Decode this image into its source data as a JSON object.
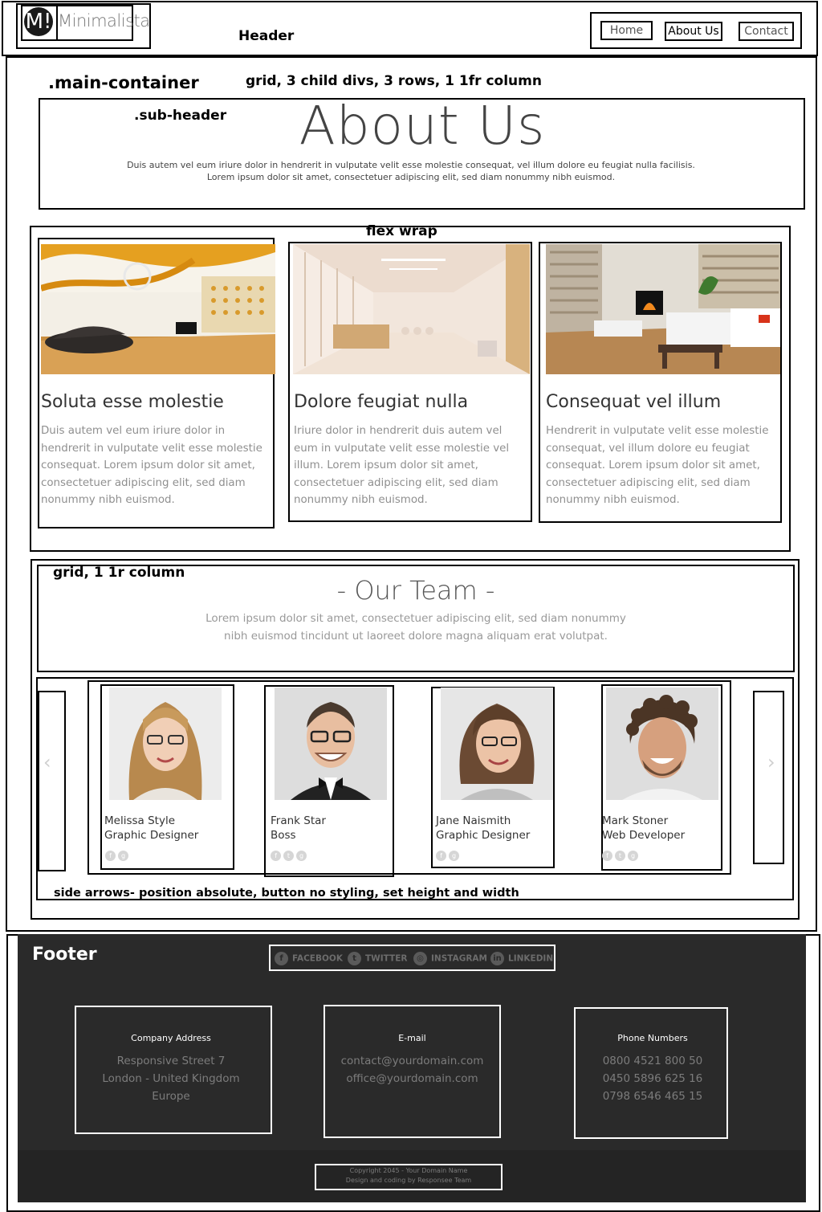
{
  "header": {
    "logo_mark": "M!",
    "logo_text": "Minimalista",
    "nav": [
      "Home",
      "About Us",
      "Contact"
    ]
  },
  "annotations": {
    "header": "Header",
    "main_container": ".main-container",
    "main_grid": "grid, 3 child divs, 3 rows, 1 1fr column",
    "sub_header": ".sub-header",
    "flex_wrap": "flex wrap",
    "team_grid": "grid, 1 1r column",
    "side_arrows": "side arrows- position absolute, button no  styling, set height and width",
    "footer": "Footer"
  },
  "about": {
    "title": "About Us",
    "text_line1": "Duis autem vel eum iriure dolor in hendrerit in vulputate velit esse molestie consequat, vel illum dolore eu feugiat nulla facilisis.",
    "text_line2": "Lorem ipsum dolor sit amet, consectetuer adipiscing elit, sed diam nonummy nibh euismod."
  },
  "cards": [
    {
      "title": "Soluta esse molestie",
      "text": "Duis autem vel eum iriure dolor in hendrerit in vulputate velit esse molestie consequat. Lorem ipsum dolor sit amet, consectetuer adipiscing elit, sed diam nonummy nibh euismod."
    },
    {
      "title": "Dolore feugiat nulla",
      "text": "Iriure dolor in hendrerit duis autem vel eum in vulputate velit esse molestie vel illum. Lorem ipsum dolor sit amet, consectetuer adipiscing elit, sed diam nonummy nibh euismod."
    },
    {
      "title": "Consequat vel illum",
      "text": "Hendrerit in vulputate velit esse molestie consequat, vel illum dolore eu feugiat consequat. Lorem ipsum dolor sit amet, consectetuer adipiscing elit, sed diam nonummy nibh euismod."
    }
  ],
  "team": {
    "title": "- Our Team -",
    "text_line1": "Lorem ipsum dolor sit amet, consectetuer adipiscing elit, sed diam nonummy",
    "text_line2": "nibh euismod tincidunt ut laoreet dolore magna aliquam erat volutpat.",
    "arrow_left": "‹",
    "arrow_right": "›",
    "members": [
      {
        "name": "Melissa Style",
        "role": "Graphic Designer"
      },
      {
        "name": "Frank Star",
        "role": "Boss"
      },
      {
        "name": "Jane Naismith",
        "role": "Graphic Designer"
      },
      {
        "name": "Mark Stoner",
        "role": "Web Developer"
      }
    ],
    "social_icons": [
      "facebook-icon",
      "twitter-icon",
      "google-plus-icon"
    ]
  },
  "footer": {
    "social": [
      "FACEBOOK",
      "TWITTER",
      "INSTAGRAM",
      "LINKEDIN"
    ],
    "columns": [
      {
        "heading": "Company Address",
        "lines": [
          "Responsive Street 7",
          "London - United Kingdom",
          "Europe"
        ]
      },
      {
        "heading": "E-mail",
        "lines": [
          "contact@yourdomain.com",
          "office@yourdomain.com"
        ]
      },
      {
        "heading": "Phone Numbers",
        "lines": [
          "0800 4521 800 50",
          "0450 5896 625 16",
          "0798 6546 465 15"
        ]
      }
    ],
    "copyright_line1": "Copyright 2045 - Your Domain Name",
    "copyright_line2": "Design and coding by Responsee Team"
  },
  "colors": {
    "footer_bg": "#2a2a2a",
    "outline": "#000000",
    "muted_text": "#8f8f8f"
  }
}
